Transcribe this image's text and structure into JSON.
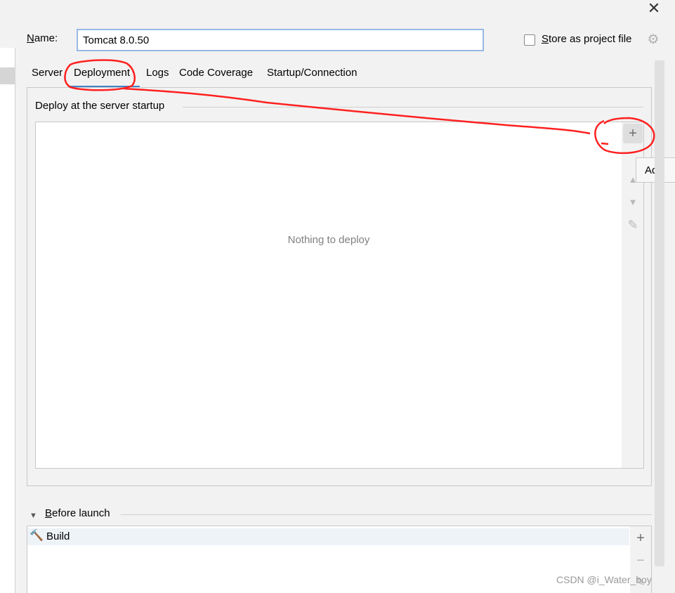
{
  "window": {
    "close_icon": "close-icon"
  },
  "name_field": {
    "label_mnemonic": "N",
    "label_rest": "ame:",
    "value": "Tomcat 8.0.50"
  },
  "store_as_project": {
    "mnemonic": "S",
    "label_rest": "tore as project file",
    "checked": false
  },
  "tabs": [
    {
      "label": "Server",
      "active": false
    },
    {
      "label": "Deployment",
      "active": true
    },
    {
      "label": "Logs",
      "active": false
    },
    {
      "label": "Code Coverage",
      "active": false
    },
    {
      "label": "Startup/Connection",
      "active": false
    }
  ],
  "deploy": {
    "section_label": "Deploy at the server startup",
    "empty_text": "Nothing to deploy",
    "toolbar": [
      "add-icon",
      "move-up-icon",
      "move-down-icon",
      "edit-icon"
    ],
    "tooltip": "Add"
  },
  "before_launch": {
    "mnemonic": "B",
    "label_rest": "efore launch",
    "items": [
      {
        "label": "Build",
        "icon": "hammer-icon"
      }
    ],
    "toolbar": [
      "add-icon",
      "remove-icon",
      "edit-icon"
    ]
  },
  "watermark": "CSDN @i_Water_boy",
  "colors": {
    "accent": "#4083c9",
    "annotation": "#ff2020"
  }
}
